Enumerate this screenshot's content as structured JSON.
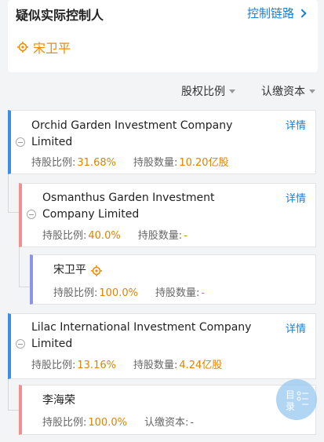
{
  "header": {
    "title": "疑似实际控制人",
    "link_label": "控制链路",
    "controller_name": "宋卫平"
  },
  "filters": {
    "equity_ratio": "股权比例",
    "subscribed_capital": "认缴资本"
  },
  "labels": {
    "detail": "详情",
    "ratio": "持股比例:",
    "quantity": "持股数量:",
    "subscribed": "认缴资本:"
  },
  "entries": [
    {
      "name_line1": "Orchid Garden Investment Company",
      "name_line2": "Limited",
      "ratio": "31.68%",
      "quantity": "10.20亿股"
    },
    {
      "name_line1": "Osmanthus Garden Investment",
      "name_line2": "Company Limited",
      "ratio": "40.0%",
      "quantity": "-"
    },
    {
      "name_line1": "宋卫平",
      "ratio": "100.0%",
      "quantity": "-"
    },
    {
      "name_line1": "Lilac International Investment Company",
      "name_line2": "Limited",
      "ratio": "13.16%",
      "quantity": "4.24亿股"
    },
    {
      "name_line1": "李海荣",
      "ratio": "100.0%",
      "subscribed": "-"
    }
  ],
  "toc": {
    "line1": "目",
    "line2": "录"
  },
  "colors": {
    "accent": "#1a7fd4",
    "value": "#e08300",
    "blue_border": "#3d8fe6",
    "pink_border": "#f08f90",
    "purple_border": "#8b95e8"
  },
  "icons": [
    "chevron-right-icon",
    "target-icon",
    "caret-down-icon",
    "collapse-icon",
    "list-icon"
  ]
}
